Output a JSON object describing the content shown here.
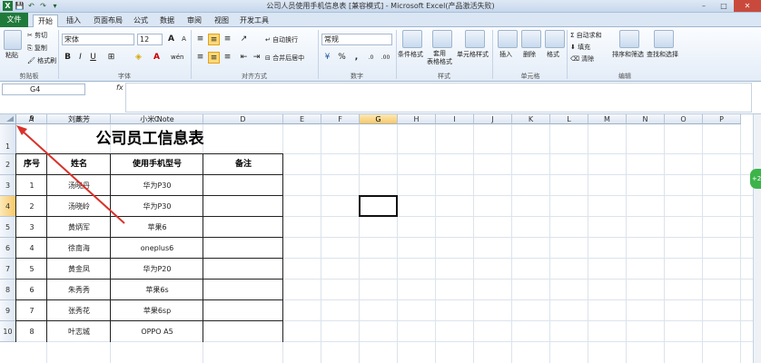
{
  "window": {
    "title": "公司人员使用手机信息表  [兼容模式] - Microsoft Excel(产品激活失败)",
    "minimize": "–",
    "maximize": "□",
    "close": "✕"
  },
  "quick_access": [
    "💾",
    "↶",
    "↷",
    "▾"
  ],
  "tabs": [
    "文件",
    "开始",
    "插入",
    "页面布局",
    "公式",
    "数据",
    "审阅",
    "视图",
    "开发工具"
  ],
  "ribbon": {
    "clipboard": {
      "paste": "粘贴",
      "cut": "剪切",
      "copy": "复制",
      "format_painter": "格式刷",
      "group": "剪贴板"
    },
    "font": {
      "name": "宋体",
      "size": "12",
      "bold": "B",
      "italic": "I",
      "underline": "U",
      "group": "字体",
      "grow": "A",
      "shrink": "A",
      "phonetic": "wén"
    },
    "alignment": {
      "wrap": "自动换行",
      "merge": "合并后居中",
      "group": "对齐方式"
    },
    "number": {
      "format": "常规",
      "group": "数字",
      "percent": "%",
      "comma": ",",
      "currency": "¥"
    },
    "styles": {
      "conditional": "条件格式",
      "table": "套用\n表格格式",
      "cell_styles": "单元格样式",
      "group": "样式"
    },
    "cells": {
      "insert": "插入",
      "delete": "删除",
      "format": "格式",
      "group": "单元格"
    },
    "editing": {
      "autosum": "自动求和",
      "fill": "填充",
      "clear": "清除",
      "sort": "排序和筛选",
      "find": "查找和选择",
      "group": "编辑"
    }
  },
  "formula_bar": {
    "name_box": "G4",
    "fx": "fx",
    "value": ""
  },
  "columns": [
    "A",
    "B",
    "C",
    "D",
    "E",
    "F",
    "G",
    "H",
    "I",
    "J",
    "K",
    "L",
    "M",
    "N",
    "O",
    "P"
  ],
  "rows": [
    "1",
    "2",
    "3",
    "4",
    "5",
    "6",
    "7",
    "8",
    "9",
    "10"
  ],
  "selected_cell": "G4",
  "sheet": {
    "title": "公司员工信息表",
    "headers": [
      "序号",
      "姓名",
      "使用手机型号",
      "备注"
    ],
    "records": [
      [
        "1",
        "汤晓丹",
        "华为P30",
        ""
      ],
      [
        "2",
        "汤晓岭",
        "华为P30",
        ""
      ],
      [
        "3",
        "黄炳军",
        "苹果6",
        ""
      ],
      [
        "4",
        "徐南海",
        "oneplus6",
        ""
      ],
      [
        "5",
        "黄金凤",
        "华为P20",
        ""
      ],
      [
        "6",
        "朱秀秀",
        "苹果6s",
        ""
      ],
      [
        "7",
        "张秀花",
        "苹果6sp",
        ""
      ],
      [
        "8",
        "叶志城",
        "OPPO A5",
        ""
      ],
      [
        "9",
        "刘燕芳",
        "小米  Note",
        ""
      ]
    ]
  },
  "side_badge": "+2",
  "colors": {
    "accent_green": "#1f7a3a",
    "annotation_arrow": "#d9322b",
    "selected_header": "#f7c868"
  }
}
